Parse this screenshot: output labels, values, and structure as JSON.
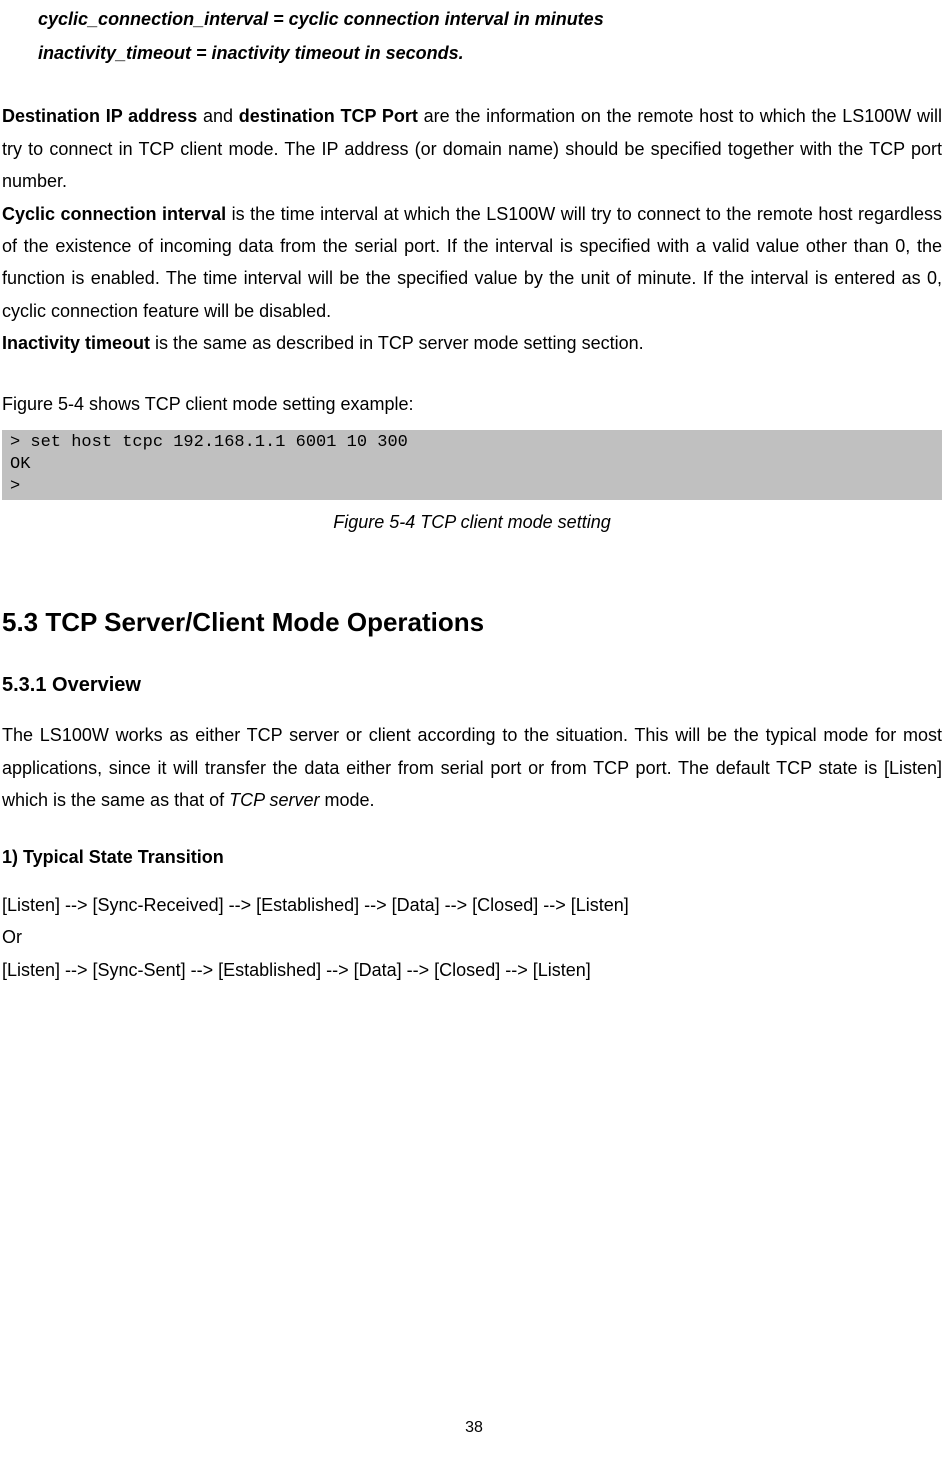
{
  "definitions": {
    "line1": "cyclic_connection_interval = cyclic connection interval in minutes",
    "line2": "inactivity_timeout = inactivity timeout in seconds."
  },
  "paragraphs": {
    "dest_lead_bold1": "Destination IP address",
    "dest_text1": " and ",
    "dest_lead_bold2": "destination TCP Port",
    "dest_text2": " are the information on the remote host to which the LS100W will try to connect in TCP client mode. The IP address (or domain name) should be specified together with the TCP port number.",
    "cyclic_bold": "Cyclic connection interval",
    "cyclic_text": " is the time interval at which the LS100W will try to connect to the remote host regardless of the existence of incoming data from the serial port. If the interval is specified with a valid value other than 0, the function is enabled. The time interval will be the specified value by the unit of minute. If the interval is entered as 0, cyclic connection feature will be disabled.",
    "inactivity_bold": "Inactivity timeout",
    "inactivity_text": " is the same as described in TCP server mode setting section.",
    "figure_intro": "Figure 5-4 shows TCP client mode setting example:"
  },
  "code": "> set host tcpc 192.168.1.1 6001 10 300\nOK\n>",
  "figure_caption": "Figure 5-4 TCP client mode setting",
  "section_heading": "5.3 TCP Server/Client Mode Operations",
  "subsection_heading": "5.3.1 Overview",
  "overview_text_pre": "The LS100W works as either TCP server or client according to the situation. This will be the typical mode for most applications, since it will transfer the data either from serial port or from TCP port. The default TCP state is [Listen] which is the same as that of ",
  "overview_text_italic": "TCP server",
  "overview_text_post": " mode.",
  "transition_heading": "1) Typical State Transition",
  "transition_line1": "[Listen] --> [Sync-Received] --> [Established] --> [Data] --> [Closed] --> [Listen]",
  "transition_or": "Or",
  "transition_line2": "[Listen] --> [Sync-Sent] --> [Established] --> [Data] --> [Closed] --> [Listen]",
  "page_number": "38"
}
